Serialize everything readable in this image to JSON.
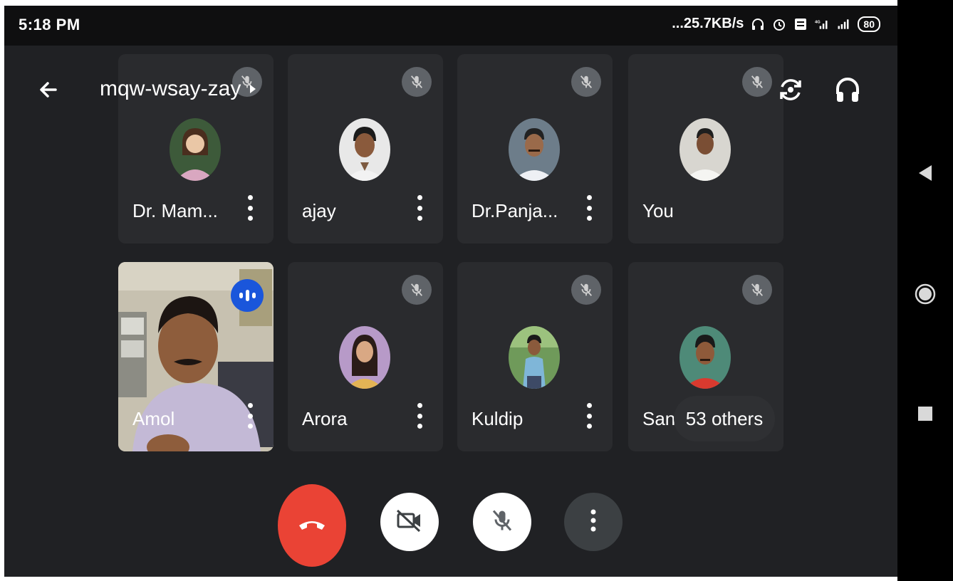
{
  "status_bar": {
    "time": "5:18 PM",
    "network_speed": "...25.7KB/s",
    "battery": "80",
    "icons": [
      "headphones-status-icon",
      "alarm-icon",
      "volte-icon",
      "signal-4g-icon",
      "signal-icon"
    ]
  },
  "header": {
    "meeting_code": "mqw-wsay-zay",
    "icons": [
      "back-arrow-icon",
      "chevron-right-icon",
      "switch-camera-icon",
      "headphones-icon"
    ]
  },
  "participants": [
    {
      "name": "Dr. Mam...",
      "muted": true
    },
    {
      "name": "ajay",
      "muted": true
    },
    {
      "name": "Dr.Panja...",
      "muted": true
    },
    {
      "name": "You",
      "muted": true
    },
    {
      "name": "Amol",
      "muted": false,
      "speaking": true,
      "video_on": true
    },
    {
      "name": "Arora",
      "muted": true
    },
    {
      "name": "Kuldip",
      "muted": true
    },
    {
      "name": "San",
      "muted": true
    }
  ],
  "others_label": "53 others",
  "controls": {
    "icons": [
      "end-call-icon",
      "camera-off-icon",
      "mic-off-icon",
      "more-options-icon"
    ]
  },
  "colors": {
    "background": "#202124",
    "tile": "#2a2b2e",
    "hangup": "#ea4335",
    "speaking_indicator": "#1a56db",
    "muted_badge": "#5f6368"
  }
}
